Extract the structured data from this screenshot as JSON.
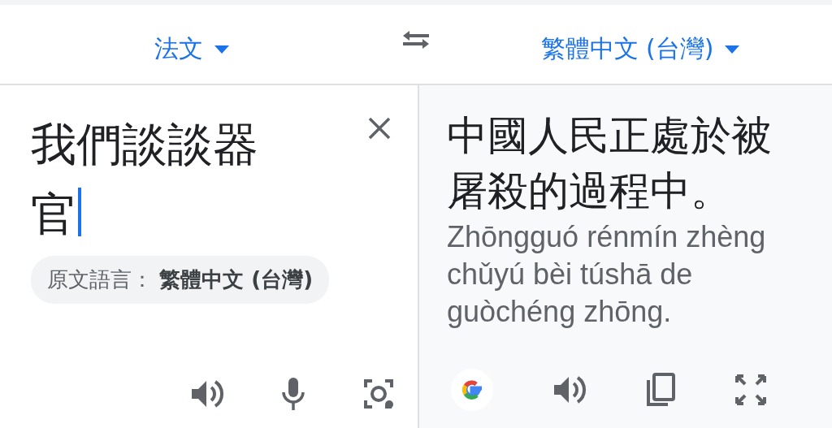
{
  "header": {
    "source_language": {
      "label": "法文"
    },
    "target_language": {
      "label": "繁體中文 (台灣)"
    }
  },
  "source": {
    "text": "我們談談器官",
    "focused": true,
    "detected_language": "原文語言： **繁體中文 (台灣)**"
  },
  "translation": {
    "text": "中國人民正處於被屠殺的過程中。",
    "romanization": "Zhōngguó rénmín zhèng chǔyú bèi túshā de guòchéng zhōng."
  }
}
